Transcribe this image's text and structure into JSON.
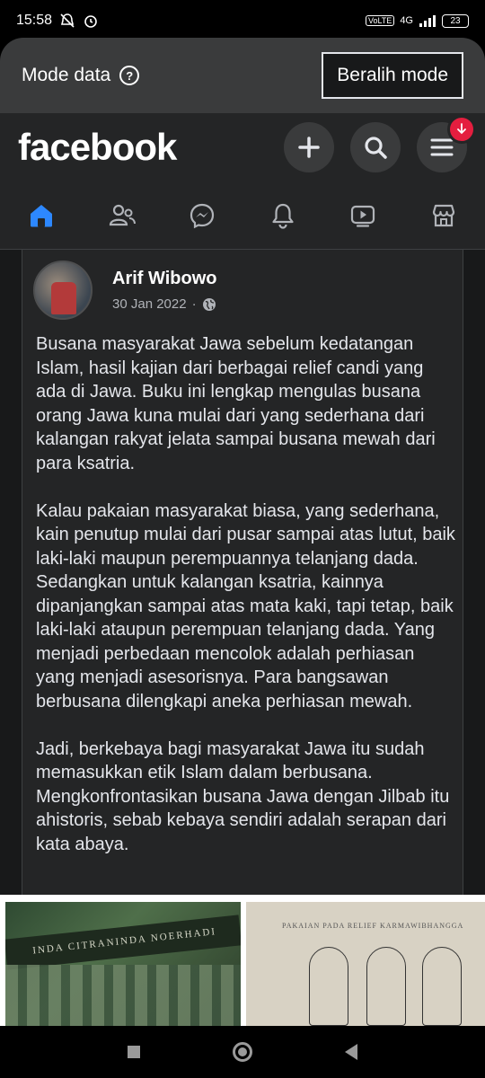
{
  "status_bar": {
    "time": "15:58",
    "network": "4G",
    "battery": "23"
  },
  "data_banner": {
    "label": "Mode data",
    "help_symbol": "?",
    "switch_label": "Beralih mode"
  },
  "header": {
    "logo": "facebook"
  },
  "tabs": [
    {
      "name": "home",
      "active": true
    },
    {
      "name": "friends"
    },
    {
      "name": "messenger"
    },
    {
      "name": "notifications"
    },
    {
      "name": "video"
    },
    {
      "name": "marketplace"
    }
  ],
  "post": {
    "author": "Arif Wibowo",
    "date": "30 Jan 2022",
    "separator": "·",
    "paragraphs": [
      "Busana masyarakat Jawa sebelum kedatangan Islam, hasil kajian dari berbagai relief candi yang ada di Jawa. Buku ini lengkap mengulas busana orang Jawa kuna mulai dari yang sederhana dari kalangan rakyat jelata sampai busana mewah dari para ksatria.",
      "Kalau pakaian masyarakat biasa, yang sederhana, kain penutup mulai dari pusar sampai atas lutut, baik laki-laki maupun perempuannya telanjang dada. Sedangkan untuk kalangan ksatria, kainnya dipanjangkan sampai atas mata kaki, tapi tetap, baik laki-laki ataupun perempuan telanjang dada. Yang menjadi perbedaan mencolok adalah perhiasan yang menjadi asesorisnya. Para bangsawan berbusana dilengkapi aneka perhiasan mewah.",
      "Jadi, berkebaya bagi masyarakat Jawa itu sudah memasukkan etik Islam dalam berbusana. Mengkonfrontasikan busana Jawa dengan Jilbab itu ahistoris, sebab kebaya sendiri adalah serapan dari kata abaya."
    ]
  },
  "photos": {
    "photo1_text": "INDA CITRANINDA NOERHADI",
    "photo2_text": "PAKAIAN PADA RELIEF KARMAWIBHANGGA"
  },
  "colors": {
    "accent": "#2d88ff",
    "badge": "#e41e3f",
    "card": "#242526"
  }
}
